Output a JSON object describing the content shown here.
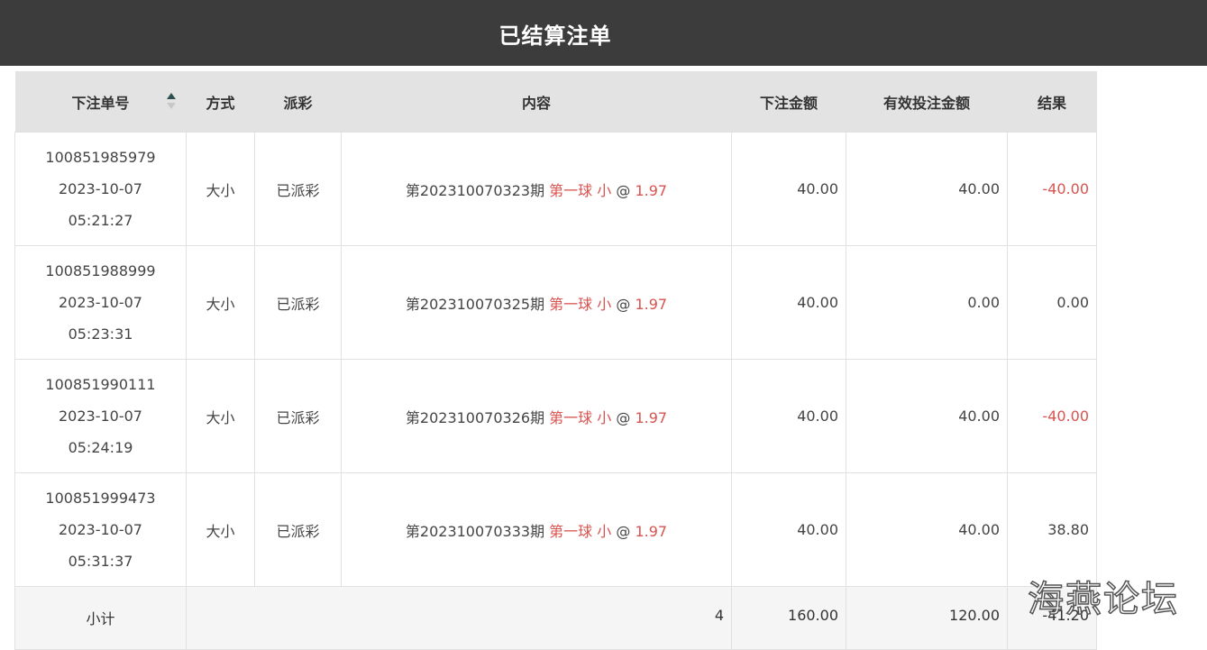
{
  "page": {
    "title": "已结算注单",
    "watermark": "海燕论坛"
  },
  "table": {
    "headers": {
      "order_no": "下注单号",
      "method": "方式",
      "payout": "派彩",
      "content": "内容",
      "bet_amount": "下注金额",
      "valid_amount": "有效投注金额",
      "result": "结果"
    },
    "rows": [
      {
        "order_no": "100851985979",
        "date": "2023-10-07",
        "time": "05:21:27",
        "method": "大小",
        "payout": "已派彩",
        "period": "第202310070323期",
        "pick": "第一球 小",
        "at": "@",
        "odds": "1.97",
        "bet_amount": "40.00",
        "valid_amount": "40.00",
        "result": "-40.00",
        "result_negative": true
      },
      {
        "order_no": "100851988999",
        "date": "2023-10-07",
        "time": "05:23:31",
        "method": "大小",
        "payout": "已派彩",
        "period": "第202310070325期",
        "pick": "第一球 小",
        "at": "@",
        "odds": "1.97",
        "bet_amount": "40.00",
        "valid_amount": "0.00",
        "result": "0.00",
        "result_negative": false
      },
      {
        "order_no": "100851990111",
        "date": "2023-10-07",
        "time": "05:24:19",
        "method": "大小",
        "payout": "已派彩",
        "period": "第202310070326期",
        "pick": "第一球 小",
        "at": "@",
        "odds": "1.97",
        "bet_amount": "40.00",
        "valid_amount": "40.00",
        "result": "-40.00",
        "result_negative": true
      },
      {
        "order_no": "100851999473",
        "date": "2023-10-07",
        "time": "05:31:37",
        "method": "大小",
        "payout": "已派彩",
        "period": "第202310070333期",
        "pick": "第一球 小",
        "at": "@",
        "odds": "1.97",
        "bet_amount": "40.00",
        "valid_amount": "40.00",
        "result": "38.80",
        "result_negative": false
      }
    ],
    "subtotal": {
      "label": "小计",
      "count": "4",
      "bet_amount": "160.00",
      "valid_amount": "120.00",
      "result": "-41.20"
    }
  },
  "colors": {
    "header_bar": "#3c3c3c",
    "table_header": "#e3e3e3",
    "accent_red": "#d9534f"
  }
}
